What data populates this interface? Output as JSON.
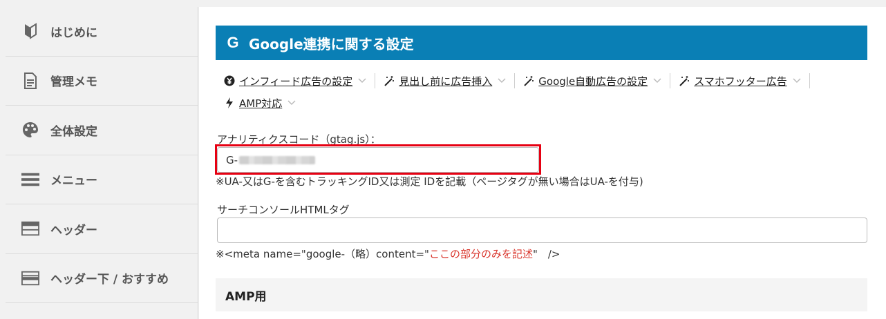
{
  "sidebar": {
    "items": [
      {
        "label": "はじめに",
        "icon": "beginner-leaf-icon"
      },
      {
        "label": "管理メモ",
        "icon": "document-icon"
      },
      {
        "label": "全体設定",
        "icon": "palette-icon"
      },
      {
        "label": "メニュー",
        "icon": "hamburger-menu-icon"
      },
      {
        "label": "ヘッダー",
        "icon": "header-layout-icon"
      },
      {
        "label": "ヘッダー下 / おすすめ",
        "icon": "header-below-layout-icon"
      }
    ]
  },
  "header": {
    "title": "Google連携に関する設定",
    "icon": "google-g-icon"
  },
  "tabs": [
    {
      "label": "インフィード広告の設定",
      "icon": "yen-coin-icon"
    },
    {
      "label": "見出し前に広告挿入",
      "icon": "magic-wand-icon"
    },
    {
      "label": "Google自動広告の設定",
      "icon": "magic-wand-icon"
    },
    {
      "label": "スマホフッター広告",
      "icon": "magic-wand-icon"
    },
    {
      "label": "AMP対応",
      "icon": "lightning-icon"
    }
  ],
  "analytics": {
    "label": "アナリティクスコード（gtag.js）：",
    "value_prefix": "G-",
    "note": "※UA-又はG-を含むトラッキングID又は測定 IDを記載（ページタグが無い場合はUA-を付与)"
  },
  "search_console": {
    "label": "サーチコンソールHTMLタグ",
    "value": "",
    "note_prefix": "※<meta name=\"google-（略）content=\"",
    "note_highlight": "ここの部分のみを記述",
    "note_suffix": "\"　/>"
  },
  "amp": {
    "title": "AMP用"
  },
  "colors": {
    "header_bg": "#0a7fb5",
    "highlight_border": "#e60012",
    "note_red": "#d9342b"
  }
}
